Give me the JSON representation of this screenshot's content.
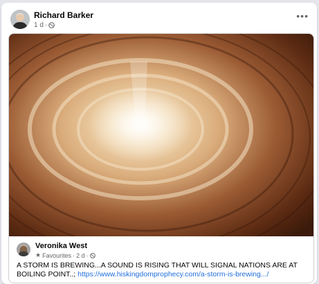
{
  "post": {
    "author": "Richard Barker",
    "time": "1 d",
    "separator": "·",
    "privacy_icon": "globe-icon",
    "more_icon": "more-horizontal-icon",
    "more_label": "•••"
  },
  "shared_post": {
    "image_icon": "storm-photo",
    "author": "Veronika West",
    "star_icon": "star-icon",
    "star_glyph": "★",
    "audience": "Favourites",
    "time": "2 d",
    "separator": "·",
    "privacy_icon": "globe-icon",
    "text": "A STORM IS BREWING...A SOUND IS RISING THAT WILL SIGNAL NATIONS ARE AT BOILING POINT..; ",
    "link": "https://www.hiskingdomprophecy.com/a-storm-is-brewing.../"
  },
  "colors": {
    "link": "#216fdb",
    "meta": "#65676b",
    "card_border": "#ced0d4"
  }
}
